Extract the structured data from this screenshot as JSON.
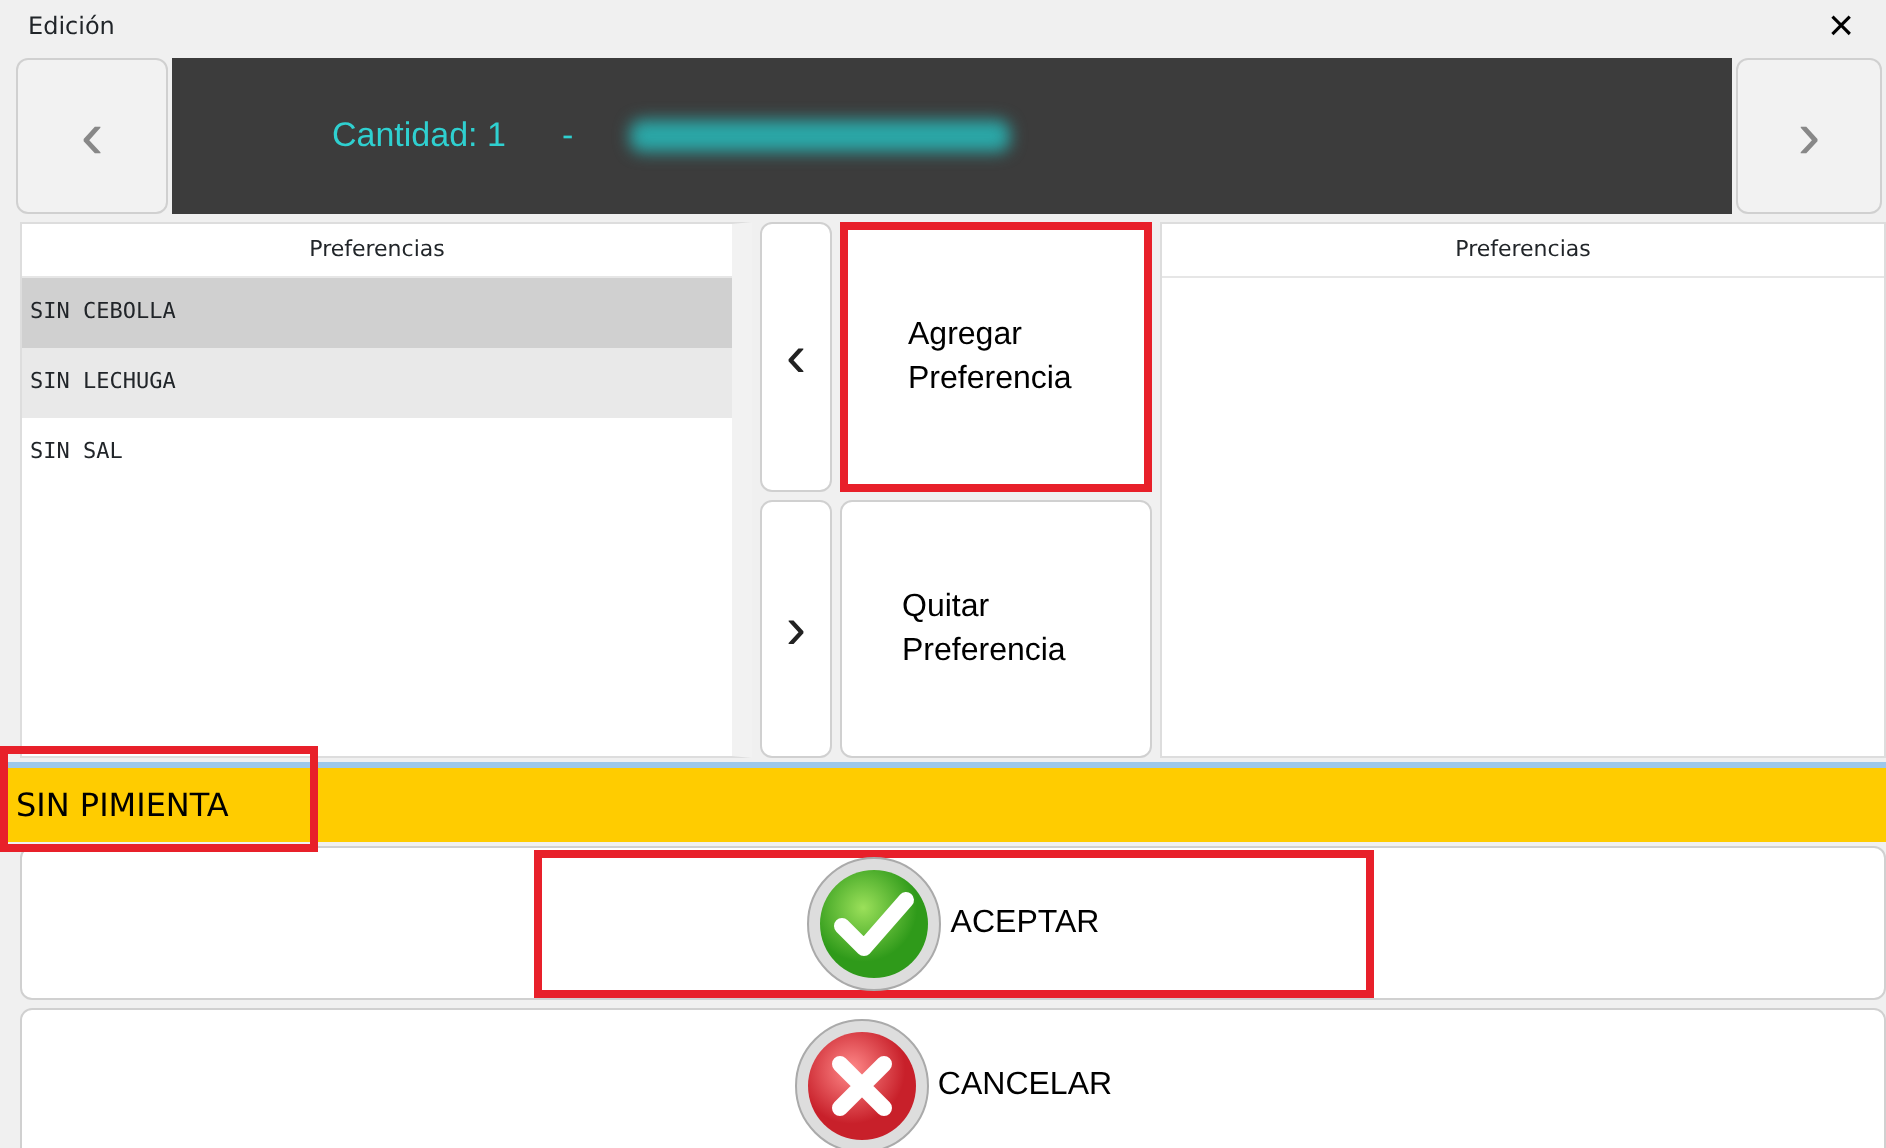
{
  "window": {
    "title": "Edición",
    "close": "×"
  },
  "header": {
    "prev": "‹",
    "quantity": "Cantidad: 1",
    "separator": "-",
    "next": "›"
  },
  "left_list": {
    "title": "Preferencias",
    "items": [
      {
        "label": "SIN CEBOLLA",
        "selected": true
      },
      {
        "label": "SIN LECHUGA",
        "selected": false
      },
      {
        "label": "SIN SAL",
        "selected": false
      }
    ]
  },
  "actions": [
    {
      "arrow": "‹",
      "label": "Agregar Preferencia",
      "highlighted": true
    },
    {
      "arrow": "›",
      "label": "Quitar Preferencia",
      "highlighted": false
    }
  ],
  "right_list": {
    "title": "Preferencias"
  },
  "input": {
    "value": "SIN PIMIENTA",
    "highlighted": true
  },
  "buttons": [
    {
      "kind": "accept",
      "label": "ACEPTAR",
      "highlighted": true
    },
    {
      "kind": "cancel",
      "label": "CANCELAR",
      "highlighted": false
    }
  ]
}
